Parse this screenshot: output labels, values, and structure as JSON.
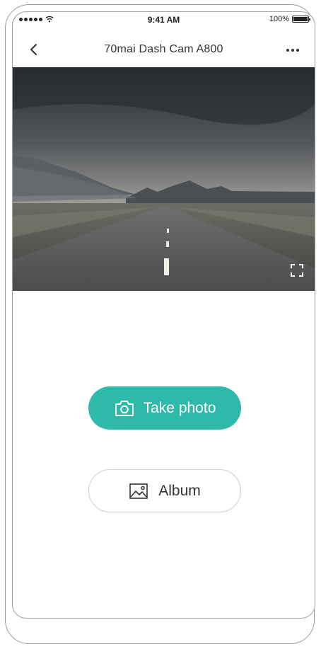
{
  "status_bar": {
    "time": "9:41 AM",
    "battery": "100%"
  },
  "nav": {
    "title": "70mai Dash Cam A800"
  },
  "actions": {
    "take_photo": "Take photo",
    "album": "Album"
  },
  "colors": {
    "accent": "#2dbaa8",
    "text": "#333333",
    "border": "#cfcfcf"
  },
  "icons": {
    "back": "chevron-left-icon",
    "more": "more-dots-icon",
    "fullscreen": "fullscreen-icon",
    "camera": "camera-icon",
    "album": "image-icon"
  }
}
